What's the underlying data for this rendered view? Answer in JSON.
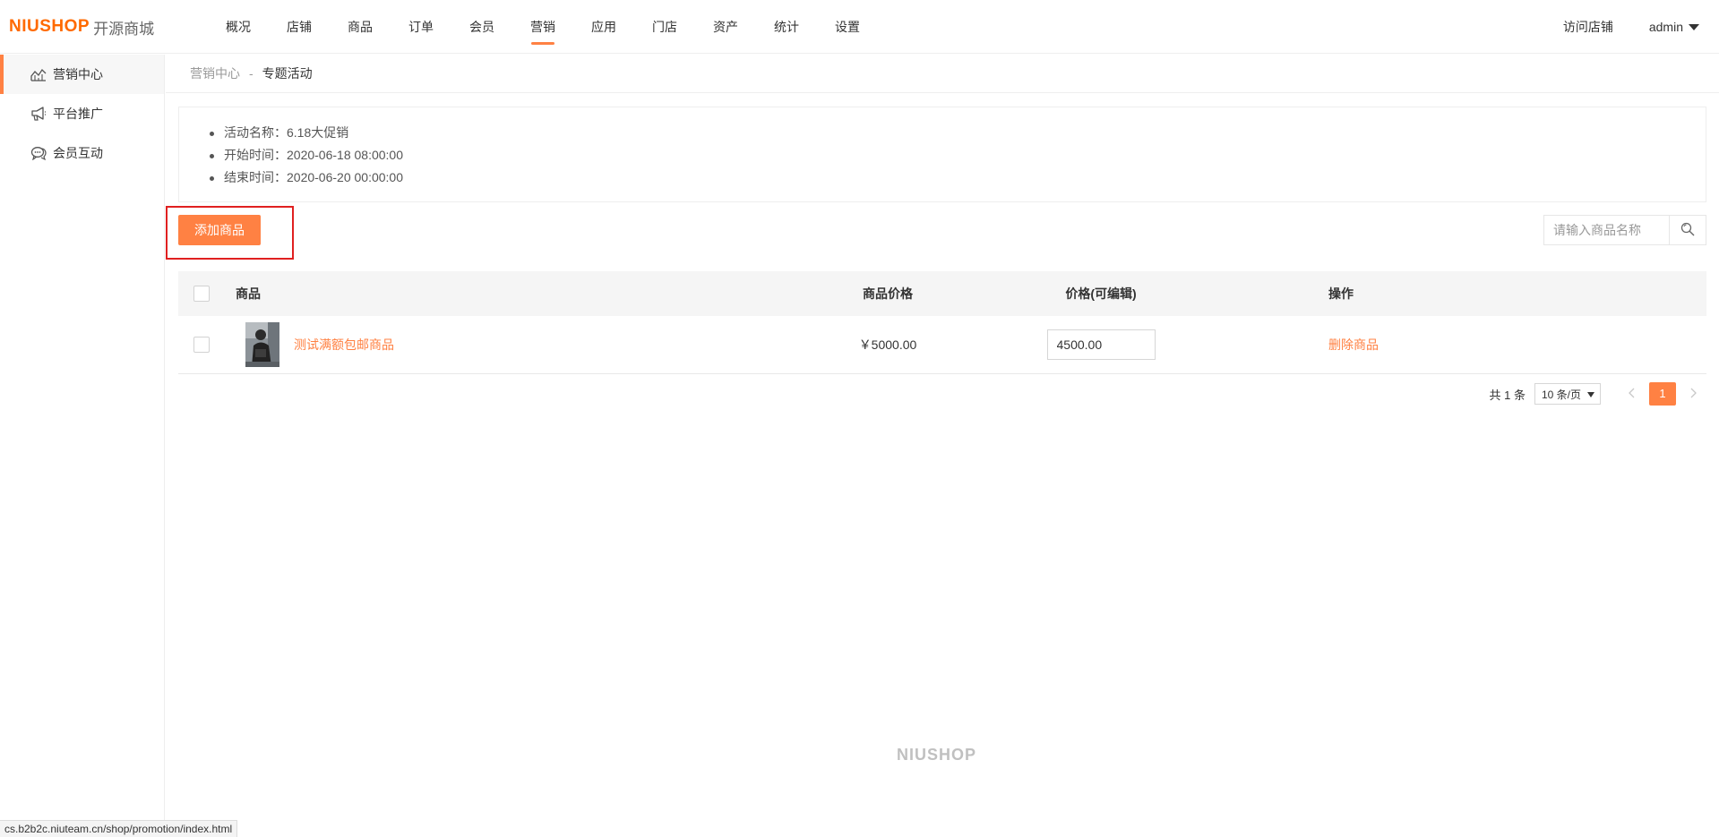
{
  "header": {
    "logo_brand": "NIUSHOP",
    "logo_sub": "开源商城",
    "nav": [
      {
        "label": "概况"
      },
      {
        "label": "店铺"
      },
      {
        "label": "商品"
      },
      {
        "label": "订单"
      },
      {
        "label": "会员"
      },
      {
        "label": "营销",
        "active": true
      },
      {
        "label": "应用"
      },
      {
        "label": "门店"
      },
      {
        "label": "资产"
      },
      {
        "label": "统计"
      },
      {
        "label": "设置"
      }
    ],
    "visit_store": "访问店铺",
    "user": "admin"
  },
  "sidebar": {
    "items": [
      {
        "label": "营销中心",
        "icon": "chart-line-icon",
        "active": true
      },
      {
        "label": "平台推广",
        "icon": "megaphone-icon"
      },
      {
        "label": "会员互动",
        "icon": "chat-bubbles-icon"
      }
    ]
  },
  "breadcrumb": {
    "parent": "营销中心",
    "separator": "-",
    "current": "专题活动"
  },
  "activity": {
    "name": "活动名称：6.18大促销",
    "start": "开始时间：2020-06-18 08:00:00",
    "end": "结束时间：2020-06-20 00:00:00"
  },
  "toolbar": {
    "add_label": "添加商品",
    "search_placeholder": "请输入商品名称"
  },
  "table": {
    "headers": {
      "goods": "商品",
      "price": "商品价格",
      "edit_price": "价格(可编辑)",
      "operation": "操作"
    },
    "rows": [
      {
        "name": "测试满额包邮商品",
        "price": "￥5000.00",
        "edit_price": "4500.00",
        "action": "删除商品"
      }
    ]
  },
  "pagination": {
    "total": "共 1 条",
    "page_size": "10 条/页",
    "current": "1"
  },
  "footer": {
    "logo": "NIUSHOP"
  },
  "status_bar": {
    "url": "cs.b2b2c.niuteam.cn/shop/promotion/index.html"
  },
  "colors": {
    "accent": "#ff8143",
    "brand": "#ff6a00",
    "highlight_border": "#e02020"
  }
}
